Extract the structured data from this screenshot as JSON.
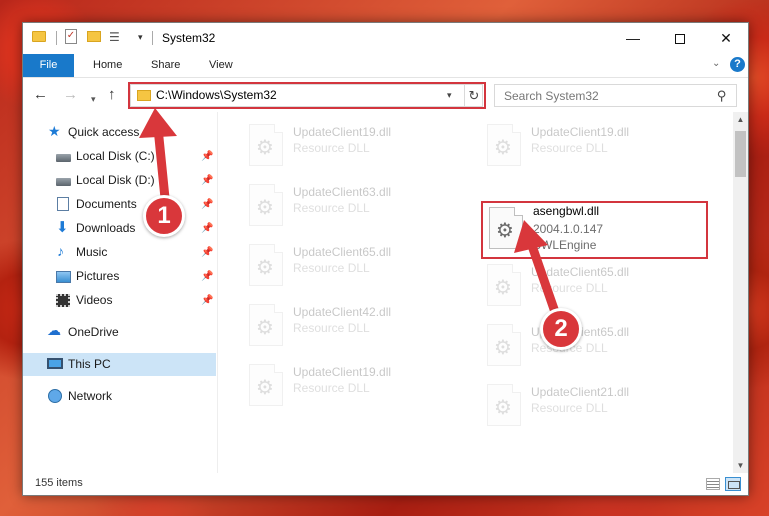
{
  "window": {
    "title": "System32",
    "controls": {
      "minimize": "—",
      "maximize": "",
      "close": "✕"
    }
  },
  "quick_access_toolbar": {
    "properties_icon": "properties-icon",
    "dropdown": "▾"
  },
  "ribbon": {
    "tabs": [
      {
        "label": "File",
        "active": true
      },
      {
        "label": "Home"
      },
      {
        "label": "Share"
      },
      {
        "label": "View"
      }
    ],
    "help_label": "?",
    "expand_glyph": "⌄"
  },
  "navigation": {
    "back": "←",
    "forward": "→",
    "recent": "▾",
    "up": "↑",
    "address": "C:\\Windows\\System32",
    "address_dropdown": "▾",
    "refresh": "↻",
    "search_placeholder": "Search System32",
    "search_glyph": "⚲"
  },
  "sidebar": {
    "items": [
      {
        "label": "Quick access",
        "icon": "star-icon",
        "pinned": false
      },
      {
        "label": "Local Disk (C:)",
        "icon": "disk-icon",
        "pinned": true
      },
      {
        "label": "Local Disk (D:)",
        "icon": "disk-icon",
        "pinned": true
      },
      {
        "label": "Documents",
        "icon": "documents-icon",
        "pinned": true
      },
      {
        "label": "Downloads",
        "icon": "downloads-icon",
        "pinned": true
      },
      {
        "label": "Music",
        "icon": "music-icon",
        "pinned": true
      },
      {
        "label": "Pictures",
        "icon": "pictures-icon",
        "pinned": true
      },
      {
        "label": "Videos",
        "icon": "videos-icon",
        "pinned": true
      },
      {
        "label": "OneDrive",
        "icon": "onedrive-icon",
        "pinned": false
      },
      {
        "label": "This PC",
        "icon": "computer-icon",
        "pinned": false,
        "selected": true
      },
      {
        "label": "Network",
        "icon": "network-icon",
        "pinned": false
      }
    ],
    "pin_glyph": "📌"
  },
  "files": {
    "faded_tiles": [
      {
        "name": "UpdateClient19.dll",
        "type": "Resource DLL"
      },
      {
        "name": "UpdateClient19.dll",
        "type": "Resource DLL"
      },
      {
        "name": "UpdateClient63.dll",
        "type": "Resource DLL"
      },
      {
        "name": "UpdateClient65.dll",
        "type": "Resource DLL"
      },
      {
        "name": "UpdateClient65.dll",
        "type": "Resource DLL"
      },
      {
        "name": "UpdateClient42.dll",
        "type": "Resource DLL"
      },
      {
        "name": "UpdateClient65.dll",
        "type": "Resource DLL"
      },
      {
        "name": "UpdateClient19.dll",
        "type": "Resource DLL"
      },
      {
        "name": "UpdateClient21.dll",
        "type": "Resource DLL"
      }
    ],
    "highlighted": {
      "name": "asengbwl.dll",
      "version": "2004.1.0.147",
      "description": "BWLEngine"
    },
    "gear_glyph": "⚙"
  },
  "scrollbar": {
    "up": "▲",
    "down": "▼"
  },
  "status": {
    "count": "155 items"
  },
  "callouts": [
    {
      "number": "1"
    },
    {
      "number": "2"
    }
  ],
  "colors": {
    "accent": "#1979ca",
    "callout": "#d9373b",
    "highlight_border": "#d3353e",
    "selected_bg": "#cce4f7"
  }
}
